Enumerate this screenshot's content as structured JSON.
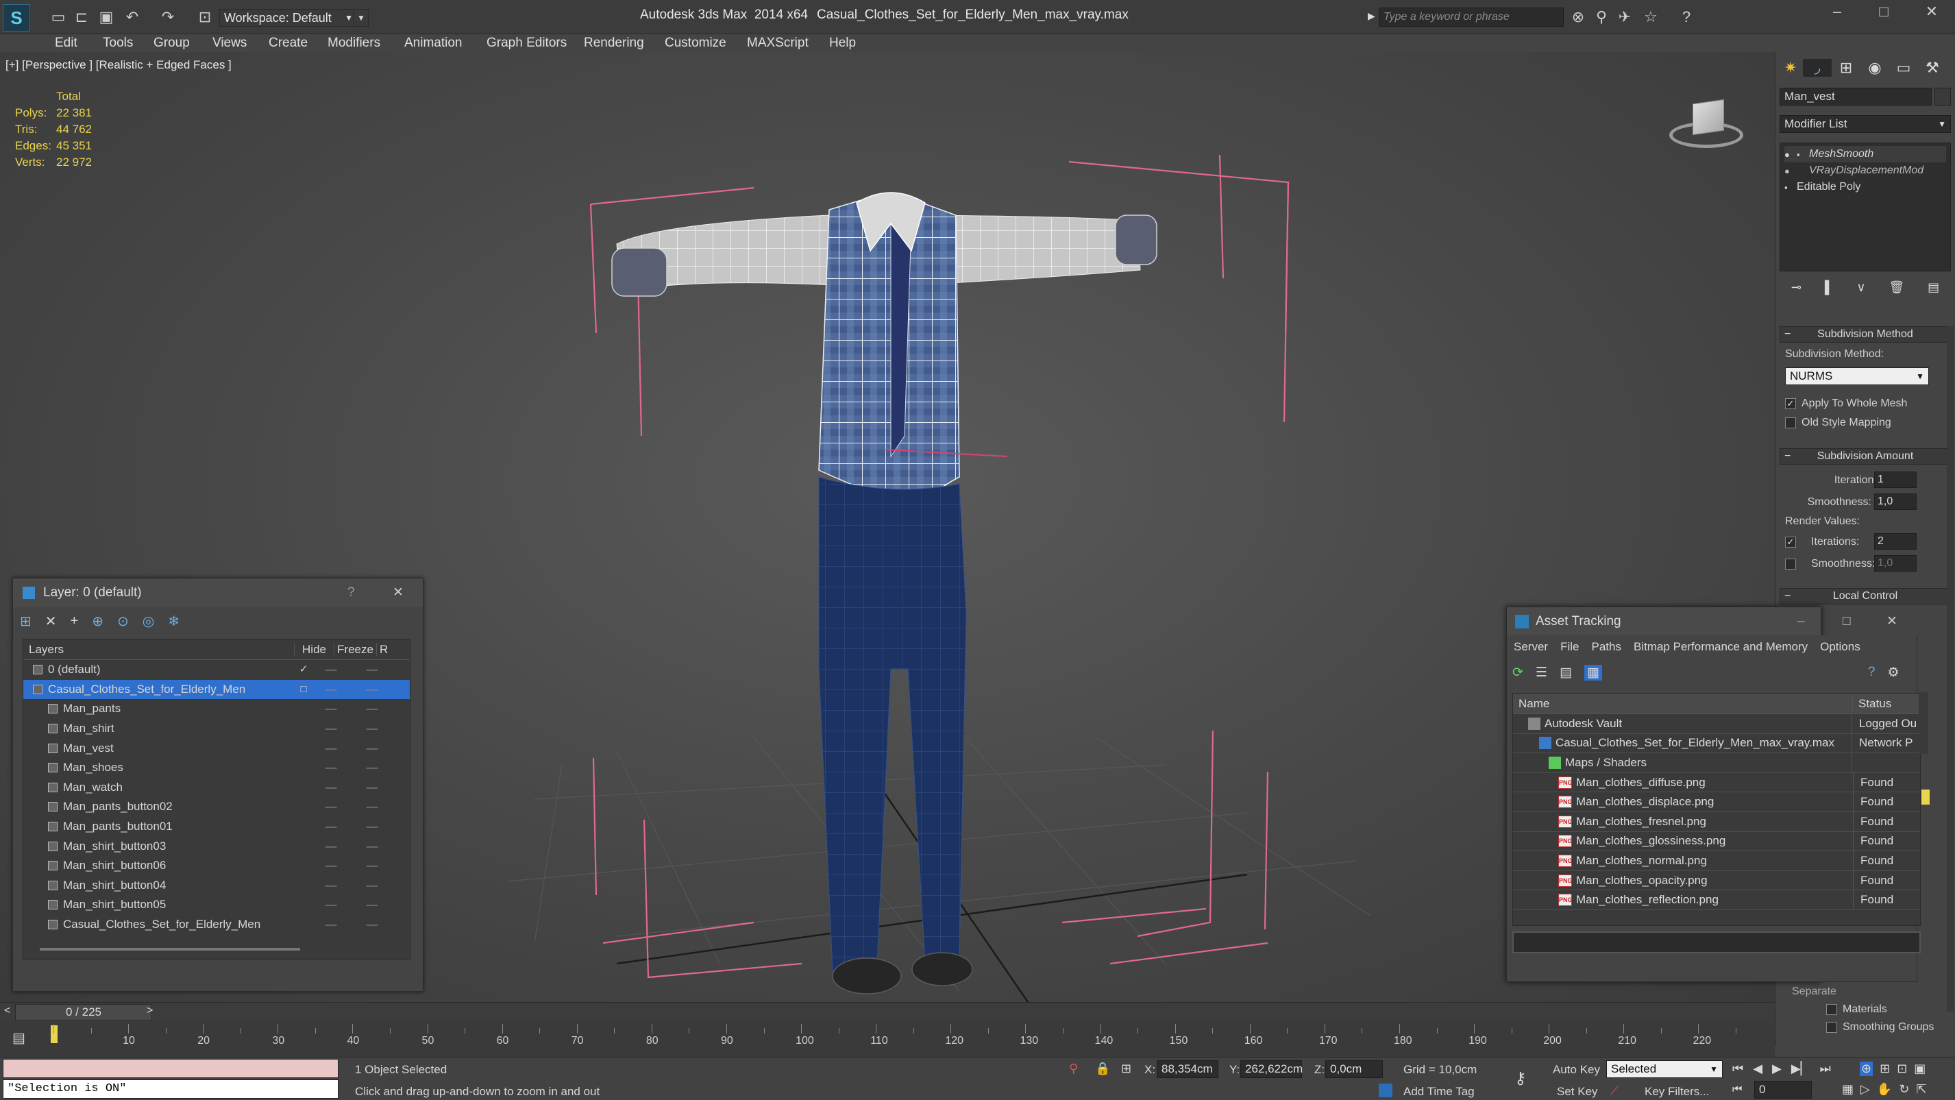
{
  "titlebar": {
    "app_title": "Autodesk 3ds Max  2014 x64",
    "file_title": "Casual_Clothes_Set_for_Elderly_Men_max_vray.max",
    "workspace": "Workspace: Default",
    "search_placeholder": "Type a keyword or phrase"
  },
  "menu": [
    "Edit",
    "Tools",
    "Group",
    "Views",
    "Create",
    "Modifiers",
    "Animation",
    "Graph Editors",
    "Rendering",
    "Customize",
    "MAXScript",
    "Help"
  ],
  "viewport": {
    "label": "[+] [Perspective ] [Realistic + Edged Faces ]",
    "stats": {
      "header": "Total",
      "rows": [
        {
          "label": "Polys:",
          "value": "22 381"
        },
        {
          "label": "Tris:",
          "value": "44 762"
        },
        {
          "label": "Edges:",
          "value": "45 351"
        },
        {
          "label": "Verts:",
          "value": "22 972"
        }
      ]
    }
  },
  "cmdpanel": {
    "object_name": "Man_vest",
    "modifier_list": "Modifier List",
    "stack": [
      "MeshSmooth",
      "VRayDisplacementMod",
      "Editable Poly"
    ],
    "subdiv_method_title": "Subdivision Method",
    "subdiv_method_label": "Subdivision Method:",
    "subdiv_method_value": "NURMS",
    "apply_whole_mesh": "Apply To Whole Mesh",
    "old_style_mapping": "Old Style Mapping",
    "subdiv_amount_title": "Subdivision Amount",
    "iterations_label": "Iterations:",
    "iterations_value": "1",
    "smoothness_label": "Smoothness:",
    "smoothness_value": "1,0",
    "render_values_label": "Render Values:",
    "render_iterations_label": "Iterations:",
    "render_iterations_value": "2",
    "render_smoothness_label": "Smoothness:",
    "render_smoothness_value": "1,0",
    "local_control_title": "Local Control",
    "separate_label": "Separate",
    "materials_label": "Materials",
    "smoothing_groups_label": "Smoothing Groups"
  },
  "layer_window": {
    "title": "Layer: 0 (default)",
    "help": "?",
    "columns": {
      "layers": "Layers",
      "hide": "Hide",
      "freeze": "Freeze",
      "extra": "R"
    },
    "rows": [
      {
        "name": "0 (default)",
        "indent": 0
      },
      {
        "name": "Casual_Clothes_Set_for_Elderly_Men",
        "indent": 0
      },
      {
        "name": "Man_pants",
        "indent": 1
      },
      {
        "name": "Man_shirt",
        "indent": 1
      },
      {
        "name": "Man_vest",
        "indent": 1
      },
      {
        "name": "Man_shoes",
        "indent": 1
      },
      {
        "name": "Man_watch",
        "indent": 1
      },
      {
        "name": "Man_pants_button02",
        "indent": 1
      },
      {
        "name": "Man_pants_button01",
        "indent": 1
      },
      {
        "name": "Man_shirt_button03",
        "indent": 1
      },
      {
        "name": "Man_shirt_button06",
        "indent": 1
      },
      {
        "name": "Man_shirt_button04",
        "indent": 1
      },
      {
        "name": "Man_shirt_button05",
        "indent": 1
      },
      {
        "name": "Casual_Clothes_Set_for_Elderly_Men",
        "indent": 1
      }
    ]
  },
  "asset_window": {
    "title": "Asset Tracking",
    "menu": [
      "Server",
      "File",
      "Paths",
      "Bitmap Performance and Memory",
      "Options"
    ],
    "col_name": "Name",
    "col_status": "Status",
    "rows": [
      {
        "name": "Autodesk Vault",
        "status": "Logged Ou",
        "icon": "vault-icon"
      },
      {
        "name": "Casual_Clothes_Set_for_Elderly_Men_max_vray.max",
        "status": "Network P",
        "icon": "max-file-icon"
      },
      {
        "name": "Maps / Shaders",
        "status": "",
        "icon": "maps-icon"
      },
      {
        "name": "Man_clothes_diffuse.png",
        "status": "Found",
        "icon": "png-icon"
      },
      {
        "name": "Man_clothes_displace.png",
        "status": "Found",
        "icon": "png-icon"
      },
      {
        "name": "Man_clothes_fresnel.png",
        "status": "Found",
        "icon": "png-icon"
      },
      {
        "name": "Man_clothes_glossiness.png",
        "status": "Found",
        "icon": "png-icon"
      },
      {
        "name": "Man_clothes_normal.png",
        "status": "Found",
        "icon": "png-icon"
      },
      {
        "name": "Man_clothes_opacity.png",
        "status": "Found",
        "icon": "png-icon"
      },
      {
        "name": "Man_clothes_reflection.png",
        "status": "Found",
        "icon": "png-icon"
      }
    ]
  },
  "timeline": {
    "frame": "0 / 225",
    "ticks": [
      "10",
      "20",
      "30",
      "40",
      "50",
      "60",
      "70",
      "80",
      "90",
      "100",
      "110",
      "120",
      "130",
      "140",
      "150",
      "160",
      "170",
      "180",
      "190",
      "200",
      "210",
      "220"
    ]
  },
  "status": {
    "script_line": "\"Selection is ON\"",
    "selected": "1 Object Selected",
    "prompt": "Click and drag up-and-down to zoom in and out",
    "x_label": "X:",
    "x_value": "88,354cm",
    "y_label": "Y:",
    "y_value": "262,622cm",
    "z_label": "Z:",
    "z_value": "0,0cm",
    "grid": "Grid = 10,0cm",
    "add_time_tag": "Add Time Tag",
    "auto_key": "Auto Key",
    "set_key": "Set Key",
    "key_mode": "Selected",
    "key_filters": "Key Filters...",
    "frame_field": "0"
  },
  "colors": {
    "selection_blue": "#2f6fce",
    "pink_brackets": "#e06a8a",
    "stats_yellow": "#e8d44d"
  }
}
